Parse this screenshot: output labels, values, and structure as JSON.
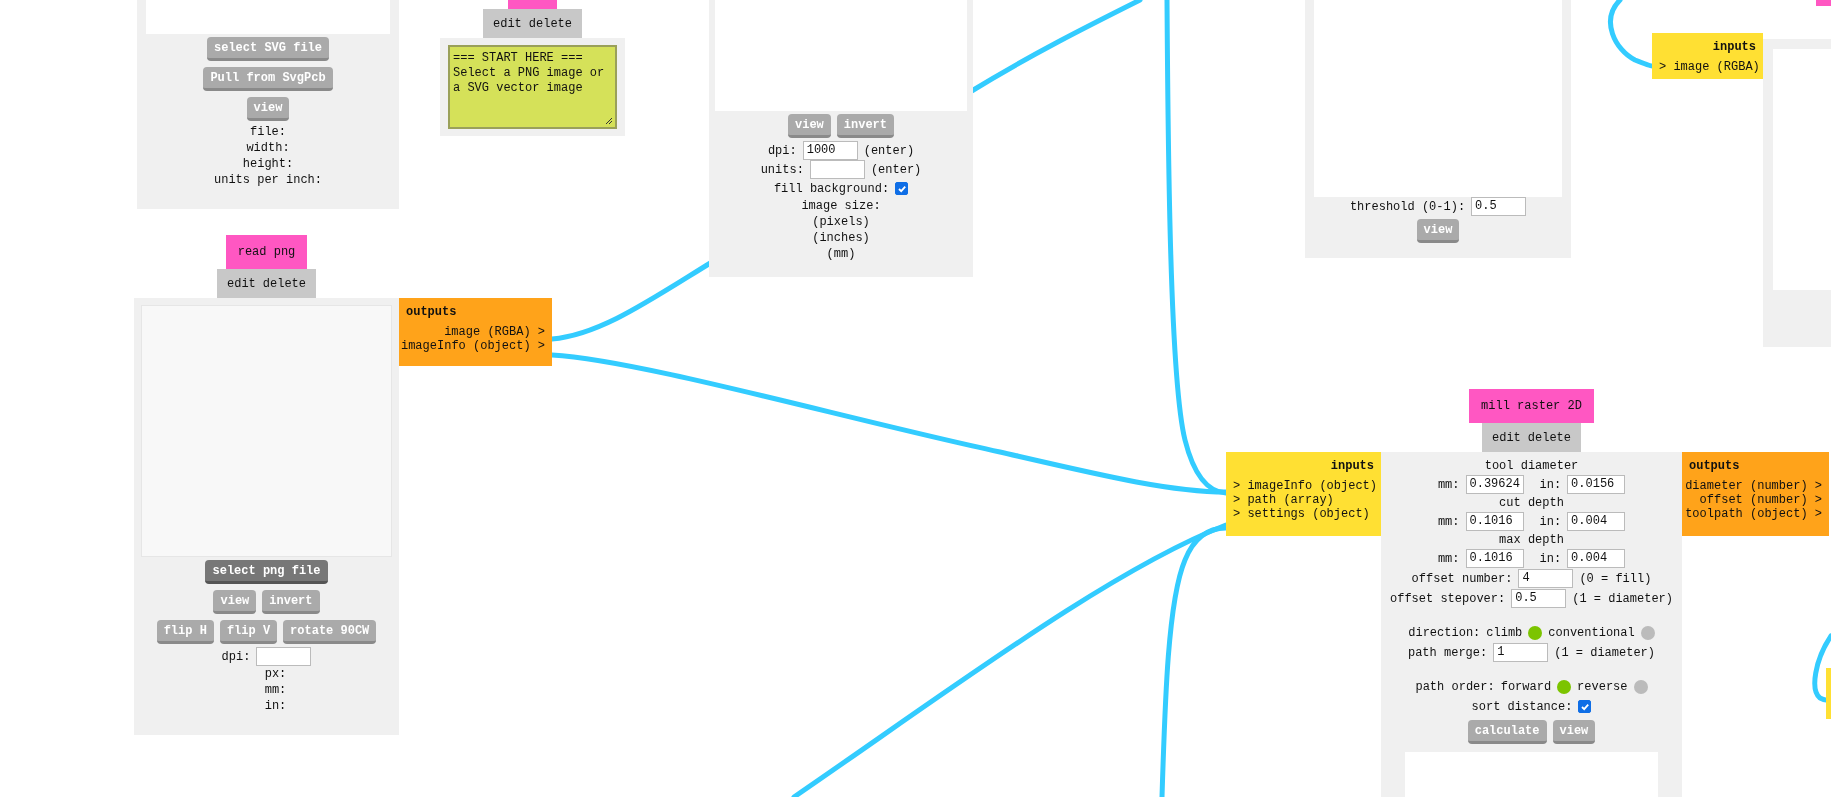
{
  "svg_reader": {
    "buttons": [
      "select SVG file",
      "Pull from SvgPcb",
      "view"
    ],
    "info": [
      "file:",
      "width:",
      "height:",
      "units per inch:"
    ]
  },
  "note": {
    "menu": [
      "edit",
      "delete"
    ],
    "lines": [
      "=== START HERE ===",
      "Select a PNG image or",
      "a SVG vector image"
    ]
  },
  "read_png": {
    "title": "read png",
    "menu": [
      "edit",
      "delete"
    ],
    "primary_button": "select png file",
    "button_rows": [
      [
        "view",
        "invert"
      ],
      [
        "flip H",
        "flip V",
        "rotate 90CW"
      ]
    ],
    "dpi_label": "dpi:",
    "info": [
      "px:",
      "mm:",
      "in:"
    ],
    "outputs": {
      "title": "outputs",
      "ports": [
        "image (RGBA) >",
        "imageInfo (object) >"
      ]
    }
  },
  "image_node": {
    "buttons": [
      "view",
      "invert"
    ],
    "rows": [
      {
        "kind": "field",
        "label": "dpi:",
        "value": "1000",
        "note": "(enter)"
      },
      {
        "kind": "field",
        "label": "units:",
        "note": "(enter)"
      },
      {
        "kind": "checkbox",
        "label": "fill background:",
        "checked": true
      },
      {
        "kind": "text",
        "text": "image size:"
      },
      {
        "kind": "text",
        "text": "(pixels)"
      },
      {
        "kind": "text",
        "text": "(inches)"
      },
      {
        "kind": "text",
        "text": "(mm)"
      }
    ]
  },
  "threshold_node": {
    "rows": [
      {
        "kind": "field",
        "label": "threshold (0-1):",
        "value": "0.5"
      }
    ],
    "buttons": [
      "view"
    ]
  },
  "right_node": {
    "inputs": {
      "title": "inputs",
      "ports": [
        "> image (RGBA)"
      ]
    }
  },
  "mill_raster": {
    "title": "mill raster 2D",
    "menu": [
      "edit",
      "delete"
    ],
    "inputs": {
      "title": "inputs",
      "ports": [
        "> imageInfo (object)",
        "> path (array)",
        "> settings (object)"
      ]
    },
    "outputs": {
      "title": "outputs",
      "ports": [
        "diameter (number) >",
        "offset (number) >",
        "toolpath (object) >"
      ]
    },
    "rows": [
      {
        "kind": "text",
        "text": "tool diameter"
      },
      {
        "kind": "pair",
        "fields": [
          {
            "label": "mm:",
            "value": "0.39624"
          },
          {
            "label": "in:",
            "value": "0.0156"
          }
        ]
      },
      {
        "kind": "text",
        "text": "cut depth"
      },
      {
        "kind": "pair",
        "fields": [
          {
            "label": "mm:",
            "value": "0.1016"
          },
          {
            "label": "in:",
            "value": "0.004"
          }
        ]
      },
      {
        "kind": "text",
        "text": "max depth"
      },
      {
        "kind": "pair",
        "fields": [
          {
            "label": "mm:",
            "value": "0.1016"
          },
          {
            "label": "in:",
            "value": "0.004"
          }
        ]
      },
      {
        "kind": "field",
        "label": "offset number:",
        "value": "4",
        "note": "(0 = fill)"
      },
      {
        "kind": "field",
        "label": "offset stepover:",
        "value": "0.5",
        "note": "(1 = diameter)"
      },
      {
        "kind": "radio",
        "label": "direction:",
        "options": [
          {
            "label": "climb",
            "selected": true
          },
          {
            "label": "conventional",
            "selected": false
          }
        ]
      },
      {
        "kind": "field",
        "label": "path merge:",
        "value": "1",
        "note": "(1 = diameter)"
      },
      {
        "kind": "radio",
        "label": "path order:",
        "options": [
          {
            "label": "forward",
            "selected": true
          },
          {
            "label": "reverse",
            "selected": false
          }
        ]
      },
      {
        "kind": "checkbox",
        "label": "sort distance:",
        "checked": true
      }
    ],
    "buttons": [
      "calculate",
      "view"
    ]
  }
}
